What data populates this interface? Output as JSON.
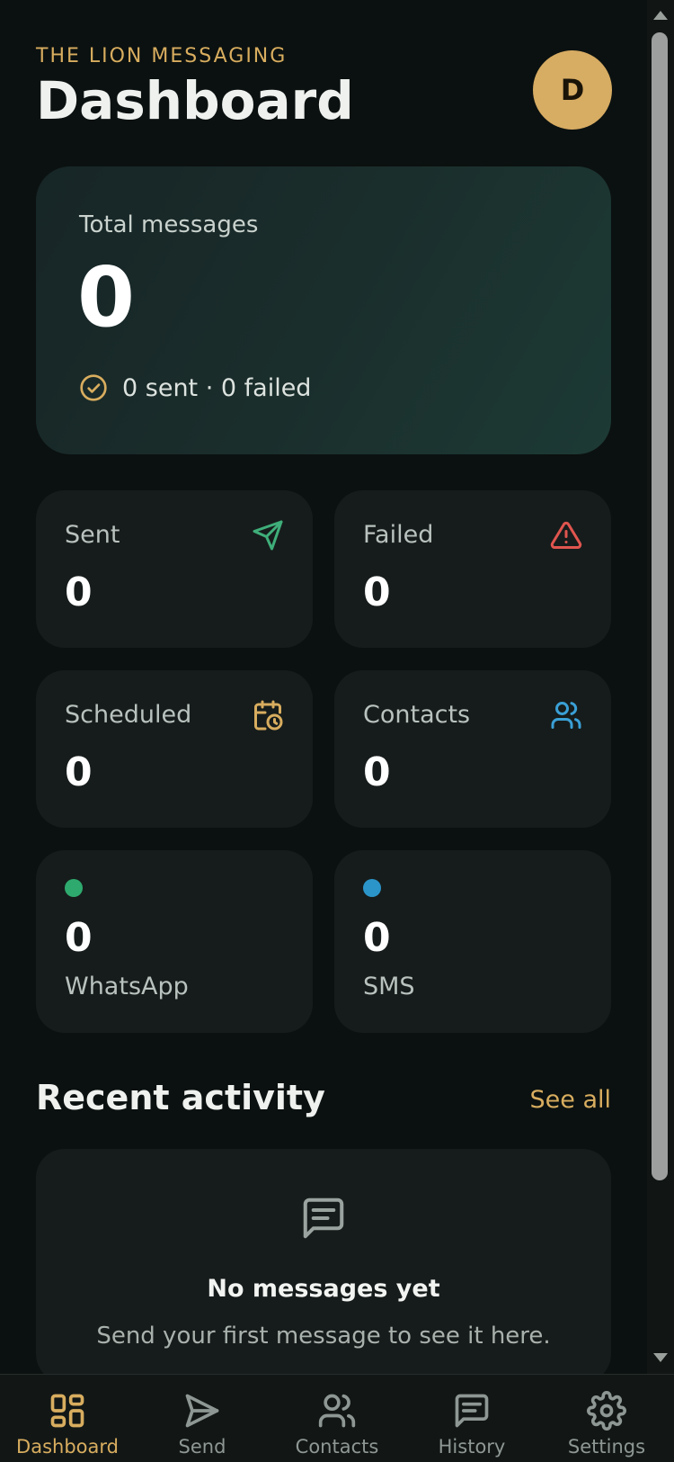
{
  "header": {
    "brand": "THE LION MESSAGING",
    "title": "Dashboard",
    "avatar_initial": "D"
  },
  "summary": {
    "label": "Total messages",
    "value": "0",
    "subtext": "0 sent · 0 failed"
  },
  "stats": [
    {
      "label": "Sent",
      "value": "0",
      "icon": "send-icon",
      "color": "#3fae7a"
    },
    {
      "label": "Failed",
      "value": "0",
      "icon": "alert-triangle-icon",
      "color": "#e0554f"
    },
    {
      "label": "Scheduled",
      "value": "0",
      "icon": "calendar-clock-icon",
      "color": "#d8ad5f"
    },
    {
      "label": "Contacts",
      "value": "0",
      "icon": "users-icon",
      "color": "#3aa0d6"
    }
  ],
  "channels": [
    {
      "label": "WhatsApp",
      "value": "0",
      "color": "#2eaa6e"
    },
    {
      "label": "SMS",
      "value": "0",
      "color": "#2b95c9"
    }
  ],
  "recent": {
    "title": "Recent activity",
    "see_all": "See all",
    "empty_title": "No messages yet",
    "empty_text": "Send your first message to see it here."
  },
  "nav": [
    {
      "label": "Dashboard",
      "icon": "grid-icon",
      "active": true
    },
    {
      "label": "Send",
      "icon": "send-icon",
      "active": false
    },
    {
      "label": "Contacts",
      "icon": "users-icon",
      "active": false
    },
    {
      "label": "History",
      "icon": "message-icon",
      "active": false
    },
    {
      "label": "Settings",
      "icon": "gear-icon",
      "active": false
    }
  ],
  "colors": {
    "accent": "#d8ad5f",
    "background": "#0b1110",
    "card": "#161c1b"
  }
}
